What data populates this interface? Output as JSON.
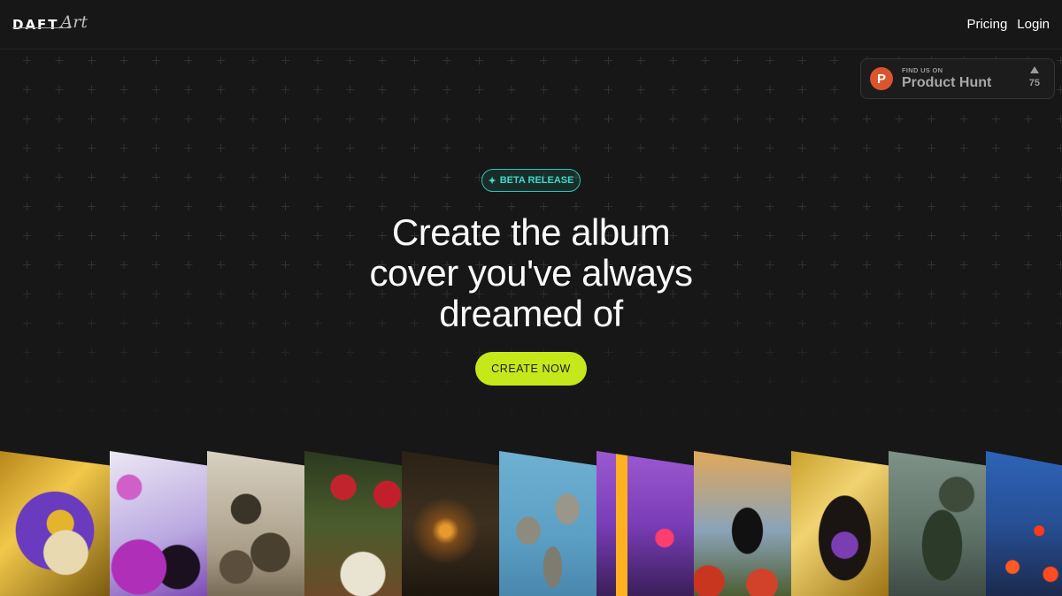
{
  "header": {
    "logo_main": "DAFT",
    "logo_script": "Art",
    "nav": [
      {
        "label": "Pricing"
      },
      {
        "label": "Login"
      }
    ]
  },
  "product_hunt": {
    "small": "FIND US ON",
    "big": "Product Hunt",
    "logo_letter": "P",
    "votes": "75"
  },
  "hero": {
    "badge": "BETA RELEASE",
    "badge_icon": "sparkle-icon",
    "headline_lines": [
      "Create the album",
      "cover you've always",
      "dreamed of"
    ],
    "cta": "CREATE NOW"
  },
  "colors": {
    "background": "#171717",
    "accent_lime": "#c5e81b",
    "accent_teal": "#2cc6b5",
    "product_hunt": "#da552f"
  },
  "covers": [
    {
      "name": "gold-skull-crown"
    },
    {
      "name": "purple-flowers-deer"
    },
    {
      "name": "ink-wash-figures"
    },
    {
      "name": "roses-skull"
    },
    {
      "name": "dark-tunnel-light"
    },
    {
      "name": "flying-dolphins"
    },
    {
      "name": "purple-street"
    },
    {
      "name": "crow-roses"
    },
    {
      "name": "golden-frame-crown"
    },
    {
      "name": "green-spaceship"
    },
    {
      "name": "night-palms-lanterns"
    }
  ]
}
